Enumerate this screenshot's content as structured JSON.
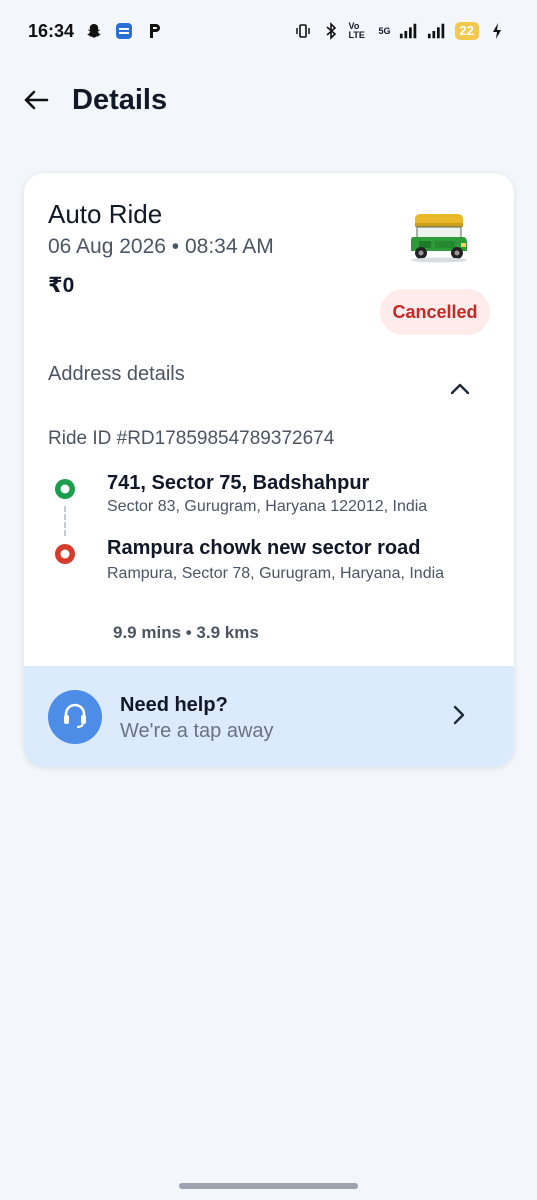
{
  "status_bar": {
    "time": "16:34",
    "battery_level": "22",
    "network": "5G",
    "volte_label": "Vo LTE",
    "icons": [
      "snapchat-icon",
      "app-icon",
      "p-icon",
      "vibrate-icon",
      "bluetooth-icon",
      "signal-icon",
      "charging-icon"
    ]
  },
  "header": {
    "title": "Details",
    "back_icon": "arrow-left-icon"
  },
  "ride": {
    "title": "Auto Ride",
    "datetime": "06 Aug 2026 • 08:34 AM",
    "fare": "₹0",
    "status": "Cancelled",
    "vehicle_icon": "auto-rickshaw-icon"
  },
  "address": {
    "label": "Address details",
    "ride_id": "Ride ID #RD17859854789372674",
    "pickup": {
      "title": "741, Sector 75, Badshahpur",
      "subtitle": "Sector 83, Gurugram, Haryana 122012, India"
    },
    "drop": {
      "title": "Rampura chowk new sector road",
      "subtitle": "Rampura, Sector 78, Gurugram, Haryana, India"
    },
    "trip_stats": "9.9 mins • 3.9 kms"
  },
  "help": {
    "title": "Need help?",
    "subtitle": "We're a tap away"
  },
  "colors": {
    "background": "#f3f6fb",
    "cancelled_text": "#c62828",
    "cancelled_bg": "#fdecea",
    "pickup_green": "#1a9e4b",
    "drop_red": "#d63c2b",
    "help_bg": "#dbeafc",
    "help_accent": "#4d8de8"
  }
}
